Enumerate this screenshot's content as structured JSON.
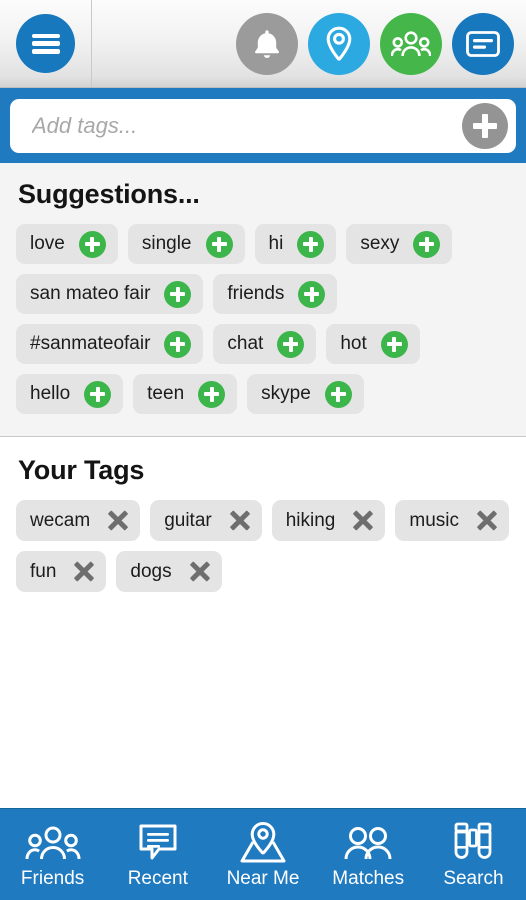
{
  "header": {
    "menu_button": "menu",
    "icons": [
      {
        "name": "notifications-icon",
        "label": "Notifications",
        "color": "#9b9b9b"
      },
      {
        "name": "location-pin-icon",
        "label": "Near Me",
        "color": "#2ba9e0"
      },
      {
        "name": "group-people-icon",
        "label": "Friends",
        "color": "#45b649"
      },
      {
        "name": "message-card-icon",
        "label": "Messages",
        "color": "#1878bd"
      }
    ]
  },
  "tag_input": {
    "value": "",
    "placeholder": "Add tags...",
    "add_button_label": "Add",
    "band_color": "#1f7ac0",
    "add_button_color": "#949494"
  },
  "suggestions": {
    "title": "Suggestions...",
    "chip_color": "#e4e4e4",
    "add_color": "#3cb54a",
    "chips": [
      {
        "label": "love"
      },
      {
        "label": "single"
      },
      {
        "label": "hi"
      },
      {
        "label": "sexy"
      },
      {
        "label": "san mateo fair"
      },
      {
        "label": "friends"
      },
      {
        "label": "#sanmateofair"
      },
      {
        "label": "chat"
      },
      {
        "label": "hot"
      },
      {
        "label": "hello"
      },
      {
        "label": "teen"
      },
      {
        "label": "skype"
      }
    ]
  },
  "your_tags": {
    "title": "Your Tags",
    "remove_color": "#6e6e6e",
    "chips": [
      {
        "label": "wecam"
      },
      {
        "label": "guitar"
      },
      {
        "label": "hiking"
      },
      {
        "label": "music"
      },
      {
        "label": "fun"
      },
      {
        "label": "dogs"
      }
    ]
  },
  "bottom_nav": {
    "background": "#1f7ac0",
    "items": [
      {
        "label": "Friends",
        "icon": "group-people-icon"
      },
      {
        "label": "Recent",
        "icon": "chat-bubble-icon"
      },
      {
        "label": "Near Me",
        "icon": "map-pin-icon"
      },
      {
        "label": "Matches",
        "icon": "two-people-icon"
      },
      {
        "label": "Search",
        "icon": "binoculars-icon"
      }
    ]
  }
}
